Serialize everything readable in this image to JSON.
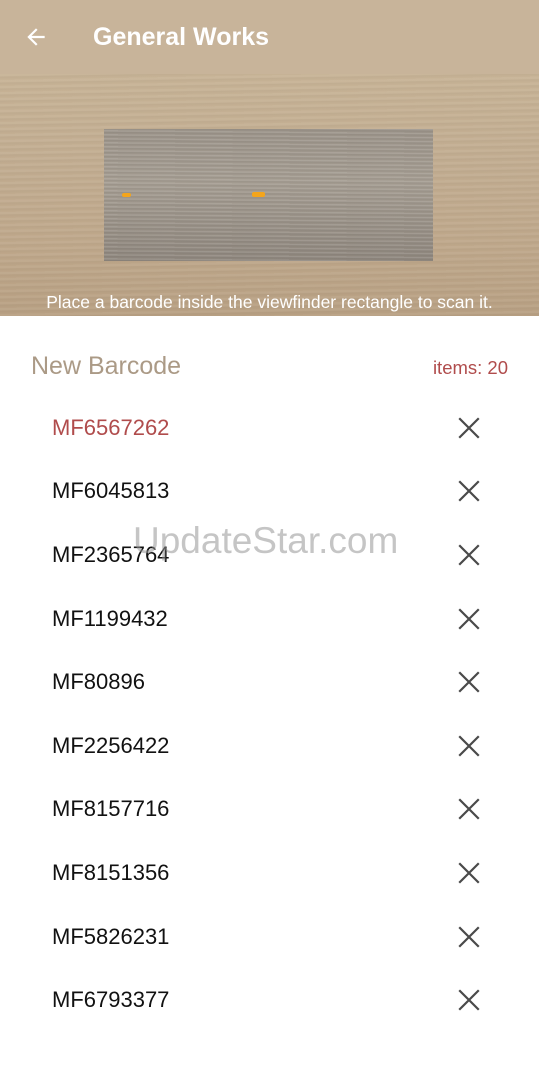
{
  "appbar": {
    "title": "General Works",
    "back_icon": "arrow-left-icon"
  },
  "scanner": {
    "hint": "Place a barcode inside the viewfinder rectangle to scan it."
  },
  "list": {
    "title": "New Barcode",
    "count_label": "items: 20",
    "highlight_color": "#b04c4c",
    "delete_icon": "close-icon",
    "items": [
      "MF6567262",
      "MF6045813",
      "MF2365764",
      "MF1199432",
      "MF80896",
      "MF2256422",
      "MF8157716",
      "MF8151356",
      "MF5826231",
      "MF6793377"
    ]
  },
  "watermark": "UpdateStar.com",
  "colors": {
    "appbar": "#c8b49a",
    "section_title": "#ab9a86"
  }
}
